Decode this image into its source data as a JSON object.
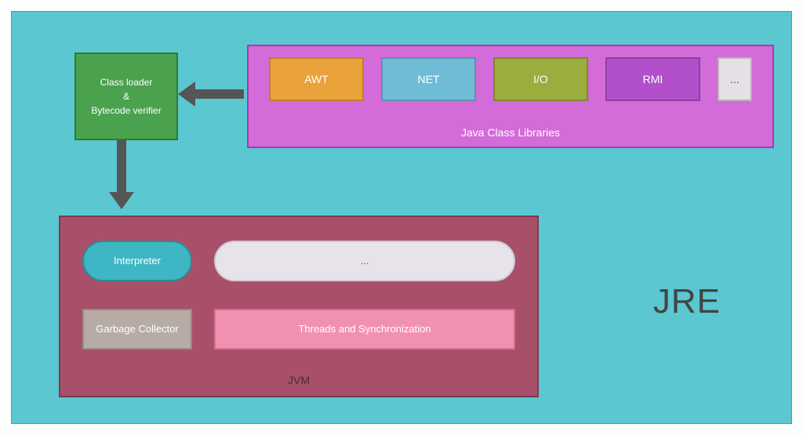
{
  "jre_label": "JRE",
  "class_loader": {
    "line1": "Class loader",
    "line2": "&",
    "line3": "Bytecode verifier"
  },
  "jcl": {
    "title": "Java Class Libraries",
    "items": [
      {
        "label": "AWT",
        "color": "#eaa23b"
      },
      {
        "label": "NET",
        "color": "#6fbcd6"
      },
      {
        "label": "I/O",
        "color": "#9aad3d"
      },
      {
        "label": "RMI",
        "color": "#b250cc"
      },
      {
        "label": "...",
        "color": "#e4e0e5",
        "more": true
      }
    ]
  },
  "jvm": {
    "title": "JVM",
    "interpreter": "Interpreter",
    "more": "...",
    "gc": "Garbage Collector",
    "threads": "Threads and Synchronization"
  }
}
